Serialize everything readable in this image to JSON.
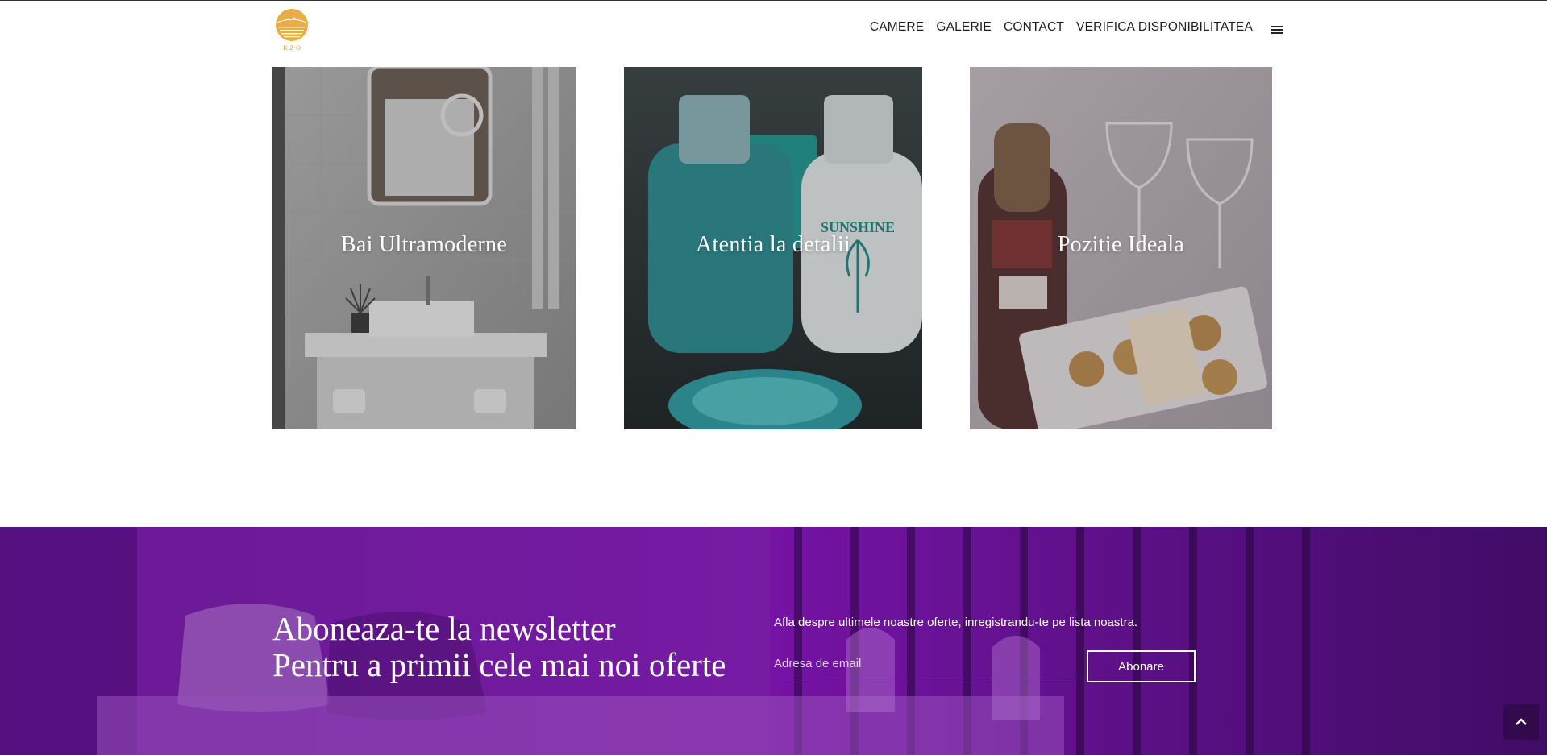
{
  "header": {
    "logo_text": "K·Z·O",
    "nav": [
      {
        "label": "CAMERE"
      },
      {
        "label": "GALERIE"
      },
      {
        "label": "CONTACT"
      },
      {
        "label": "VERIFICA DISPONIBILITATEA"
      }
    ],
    "menu_icon": "hamburger-icon"
  },
  "features": [
    {
      "title": "Bai Ultramoderne",
      "image": "bathroom-photo"
    },
    {
      "title": "Atentia la detalii",
      "image": "toiletries-photo"
    },
    {
      "title": "Pozitie Ideala",
      "image": "champagne-photo"
    }
  ],
  "newsletter": {
    "title_line1": "Aboneaza-te la newsletter",
    "title_line2": "Pentru a primii cele mai noi oferte",
    "description": "Afla despre ultimele noastre oferte, inregistrandu-te pe lista noastra.",
    "email_placeholder": "Adresa de email",
    "email_value": "",
    "button_label": "Abonare",
    "overlay_color": "#8a0fc4"
  },
  "scroll_top_icon": "chevron-up-icon",
  "colors": {
    "logo_gold": "#e3a63a",
    "text_dark": "#1e1e1e",
    "purple": "#8a0fc4"
  }
}
